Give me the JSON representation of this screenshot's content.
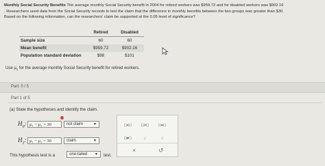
{
  "problem": {
    "heading": "Monthly Social Security Benefits",
    "line1": "The average monthly Social Security benefit in 2004 for retired workers was $959.72 and for disabled workers was $902.16",
    "line2": ". Researchers used data from the Social Security records to test the claim that the difference in monthly benefits between the two groups was greater than $30.",
    "line3": "Based on the following information, can the researchers' claim be supported at the 0.05 level of significance?"
  },
  "table": {
    "headers": [
      "",
      "Retired",
      "Disabled"
    ],
    "rows": [
      {
        "label": "Sample size",
        "retired": "60",
        "disabled": "60"
      },
      {
        "label": "Mean benefit",
        "retired": "$959.72",
        "disabled": "$902.16"
      },
      {
        "label": "Population standard deviation",
        "retired": "$98",
        "disabled": "$101"
      }
    ]
  },
  "mu_note": {
    "prefix": "Use μ",
    "sub": "1",
    "suffix": " for the average monthly Social Security benefit for retired workers."
  },
  "part_bar": "Part: 0 / 5",
  "part_label": "Part 1 of 5",
  "instruction": "(a) State the hypotheses and identify the claim.",
  "h0": {
    "label": "H",
    "sub": "0",
    "colon": ":",
    "expr": "μ₁ − μ₂ > 30",
    "claim": "not claim"
  },
  "h1": {
    "label": "H",
    "sub": "1",
    "colon": ":",
    "expr": "μ₁ − μ₂ > 30",
    "claim": "claim"
  },
  "palette": {
    "row1": [
      "□<□",
      "□>□",
      "□=□"
    ],
    "row2": [
      "□≠□",
      "μ",
      "σ"
    ],
    "clear": "×",
    "reset": "↺"
  },
  "test": {
    "prefix": "This hypothesis test is a",
    "value": "one-tailed",
    "suffix": "test."
  },
  "colors": {
    "background": "#e9e8e3",
    "error_dot": "#e53b3b"
  }
}
